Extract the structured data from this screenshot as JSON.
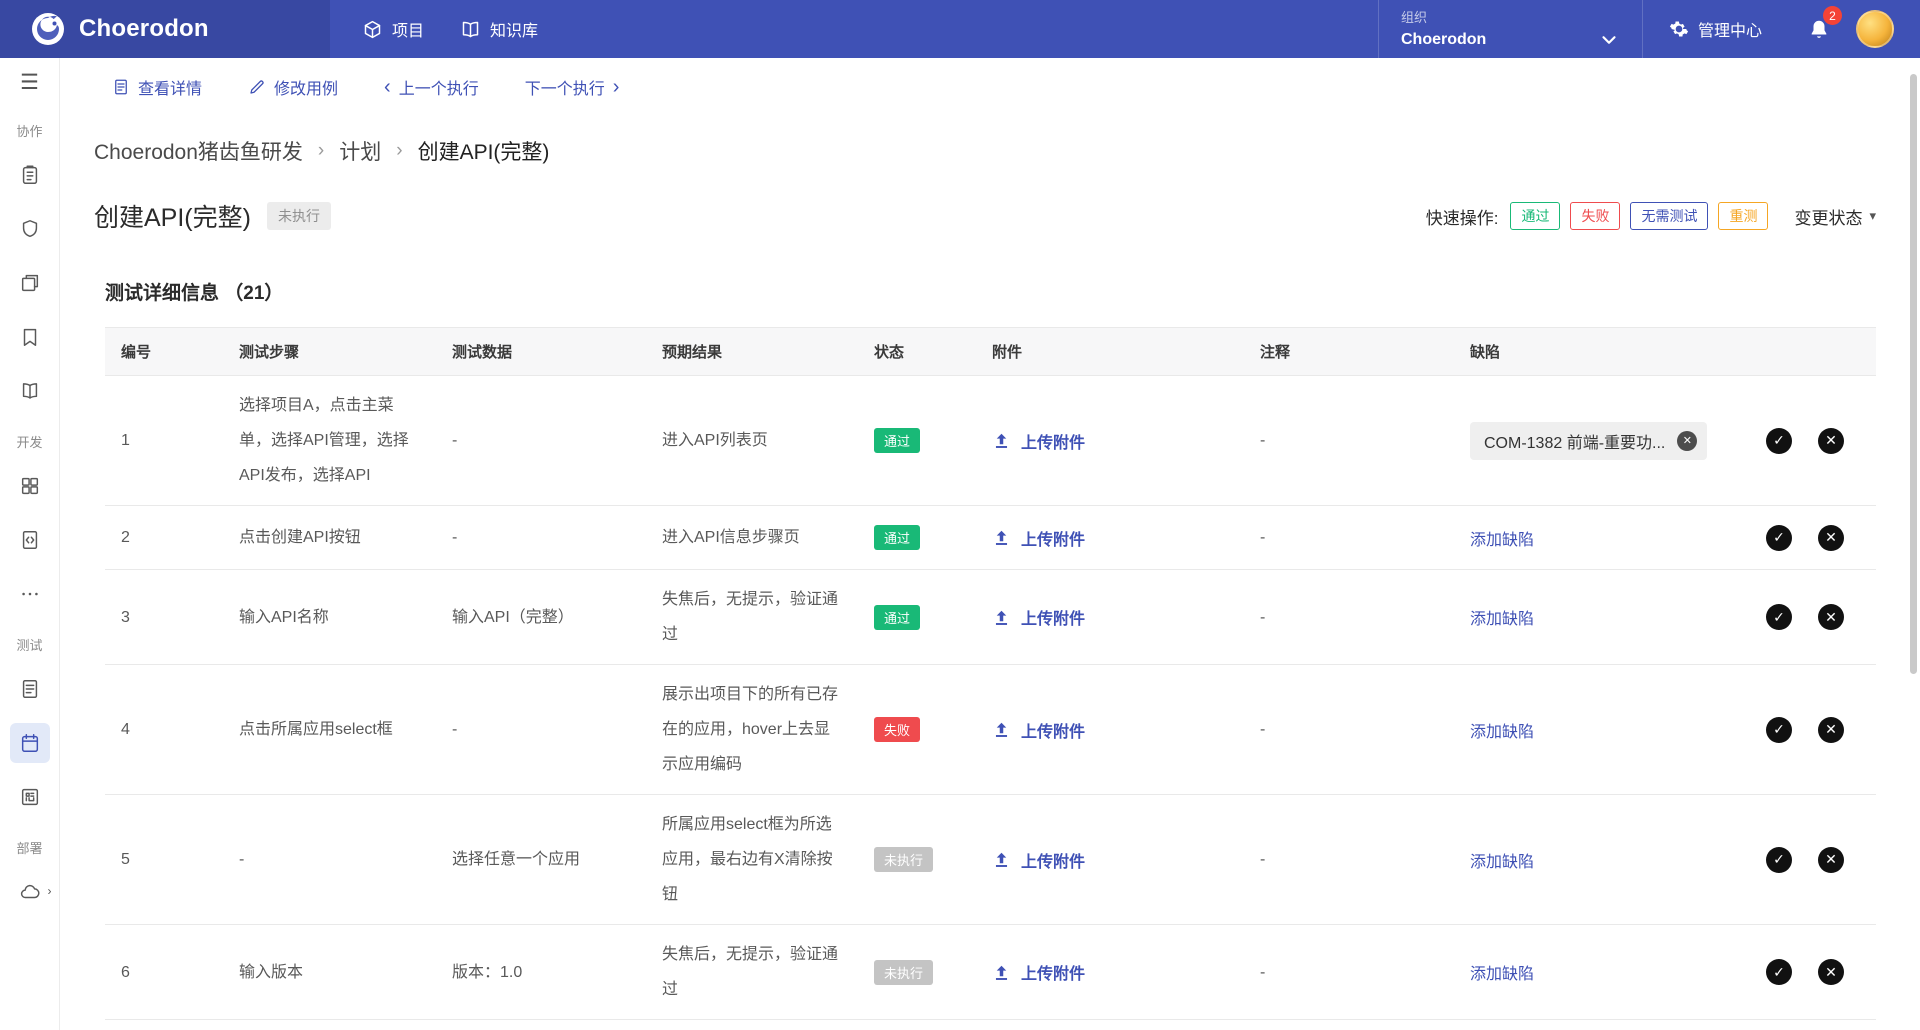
{
  "header": {
    "brand": "Choerodon",
    "nav": [
      {
        "label": "项目"
      },
      {
        "label": "知识库"
      }
    ],
    "org": {
      "label": "组织",
      "value": "Choerodon"
    },
    "admin_label": "管理中心",
    "notification_count": "2"
  },
  "sidebar": {
    "sections": [
      {
        "label": "协作"
      },
      {
        "label": "开发"
      },
      {
        "label": "测试"
      },
      {
        "label": "部署"
      }
    ]
  },
  "toolbar": {
    "view_details": "查看详情",
    "edit_case": "修改用例",
    "prev_execution": "上一个执行",
    "next_execution": "下一个执行"
  },
  "breadcrumb": {
    "items": [
      "Choerodon猪齿鱼研发",
      "计划",
      "创建API(完整)"
    ],
    "separator": "›"
  },
  "page": {
    "title": "创建API(完整)",
    "title_badge": "未执行",
    "quick_ops_label": "快速操作:",
    "quick_ops": [
      {
        "label": "通过",
        "type": "pass"
      },
      {
        "label": "失败",
        "type": "fail"
      },
      {
        "label": "无需测试",
        "type": "skip"
      },
      {
        "label": "重测",
        "type": "retest"
      }
    ],
    "change_status_label": "变更状态",
    "section_title": "测试详细信息 （21）"
  },
  "table": {
    "headers": [
      "编号",
      "测试步骤",
      "测试数据",
      "预期结果",
      "状态",
      "附件",
      "注释",
      "缺陷"
    ],
    "upload_label": "上传附件",
    "add_defect_label": "添加缺陷",
    "rows": [
      {
        "id": "1",
        "step": "选择项目A，点击主菜单，选择API管理，选择API发布，选择API",
        "data": "-",
        "expected": "进入API列表页",
        "status": "通过",
        "status_type": "pass",
        "comment": "-",
        "defect": "COM-1382 前端-重要功...",
        "defect_type": "tag"
      },
      {
        "id": "2",
        "step": "点击创建API按钮",
        "data": "-",
        "expected": "进入API信息步骤页",
        "status": "通过",
        "status_type": "pass",
        "comment": "-",
        "defect": "添加缺陷",
        "defect_type": "link"
      },
      {
        "id": "3",
        "step": "输入API名称",
        "data": "输入API（完整）",
        "expected": "失焦后，无提示，验证通过",
        "status": "通过",
        "status_type": "pass",
        "comment": "-",
        "defect": "添加缺陷",
        "defect_type": "link"
      },
      {
        "id": "4",
        "step": "点击所属应用select框",
        "data": "-",
        "expected": "展示出项目下的所有已存在的应用，hover上去显示应用编码",
        "status": "失败",
        "status_type": "fail",
        "comment": "-",
        "defect": "添加缺陷",
        "defect_type": "link"
      },
      {
        "id": "5",
        "step": "-",
        "data": "选择任意一个应用",
        "expected": "所属应用select框为所选应用，最右边有X清除按钮",
        "status": "未执行",
        "status_type": "pending",
        "comment": "-",
        "defect": "添加缺陷",
        "defect_type": "link"
      },
      {
        "id": "6",
        "step": "输入版本",
        "data": "版本：1.0",
        "expected": "失焦后，无提示，验证通过",
        "status": "未执行",
        "status_type": "pending",
        "comment": "-",
        "defect": "添加缺陷",
        "defect_type": "link"
      }
    ]
  },
  "icons": {
    "hamburger": "☰",
    "check": "✓",
    "cross": "✕",
    "caret_down": "▾",
    "chevron_left": "‹",
    "chevron_right": "›",
    "expand_right": "›"
  },
  "colors": {
    "primary_blue": "#3f51b5",
    "pass_green": "#19b977",
    "fail_red": "#ef4b4e",
    "pending_gray": "#c4c4c4",
    "retest_orange": "#f5a623",
    "notification_red": "#f44336"
  }
}
